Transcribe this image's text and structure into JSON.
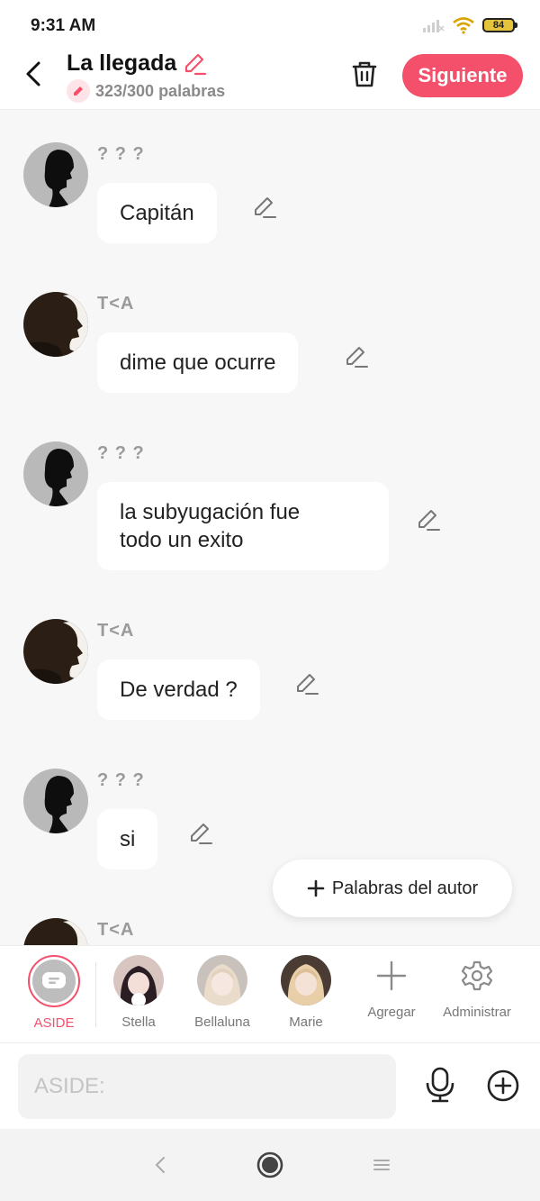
{
  "status": {
    "time": "9:31 AM",
    "battery": "84"
  },
  "header": {
    "title": "La llegada",
    "word_count": "323/300 palabras",
    "next_label": "Siguiente"
  },
  "messages": [
    {
      "name": "? ? ?",
      "text": "Capitán",
      "avatar": "silhouette-light"
    },
    {
      "name": "T<A",
      "text": "dime que ocurre",
      "avatar": "silhouette-dark"
    },
    {
      "name": "? ? ?",
      "text": "la subyugación fue\ntodo un exito",
      "avatar": "silhouette-light"
    },
    {
      "name": "T<A",
      "text": "De verdad ?",
      "avatar": "silhouette-dark"
    },
    {
      "name": "? ? ?",
      "text": "si",
      "avatar": "silhouette-light"
    },
    {
      "name": "T<A",
      "text": "",
      "avatar": "silhouette-dark"
    }
  ],
  "author_button": {
    "label": "Palabras del autor"
  },
  "characters": [
    {
      "label": "ASIDE",
      "selected": true
    },
    {
      "label": "Stella"
    },
    {
      "label": "Bellaluna"
    },
    {
      "label": "Marie"
    },
    {
      "label": "Agregar"
    },
    {
      "label": "Administrar"
    }
  ],
  "input": {
    "placeholder": "ASIDE:"
  },
  "colors": {
    "accent": "#f4506c",
    "background": "#f7f7f7",
    "bubble": "#ffffff"
  }
}
